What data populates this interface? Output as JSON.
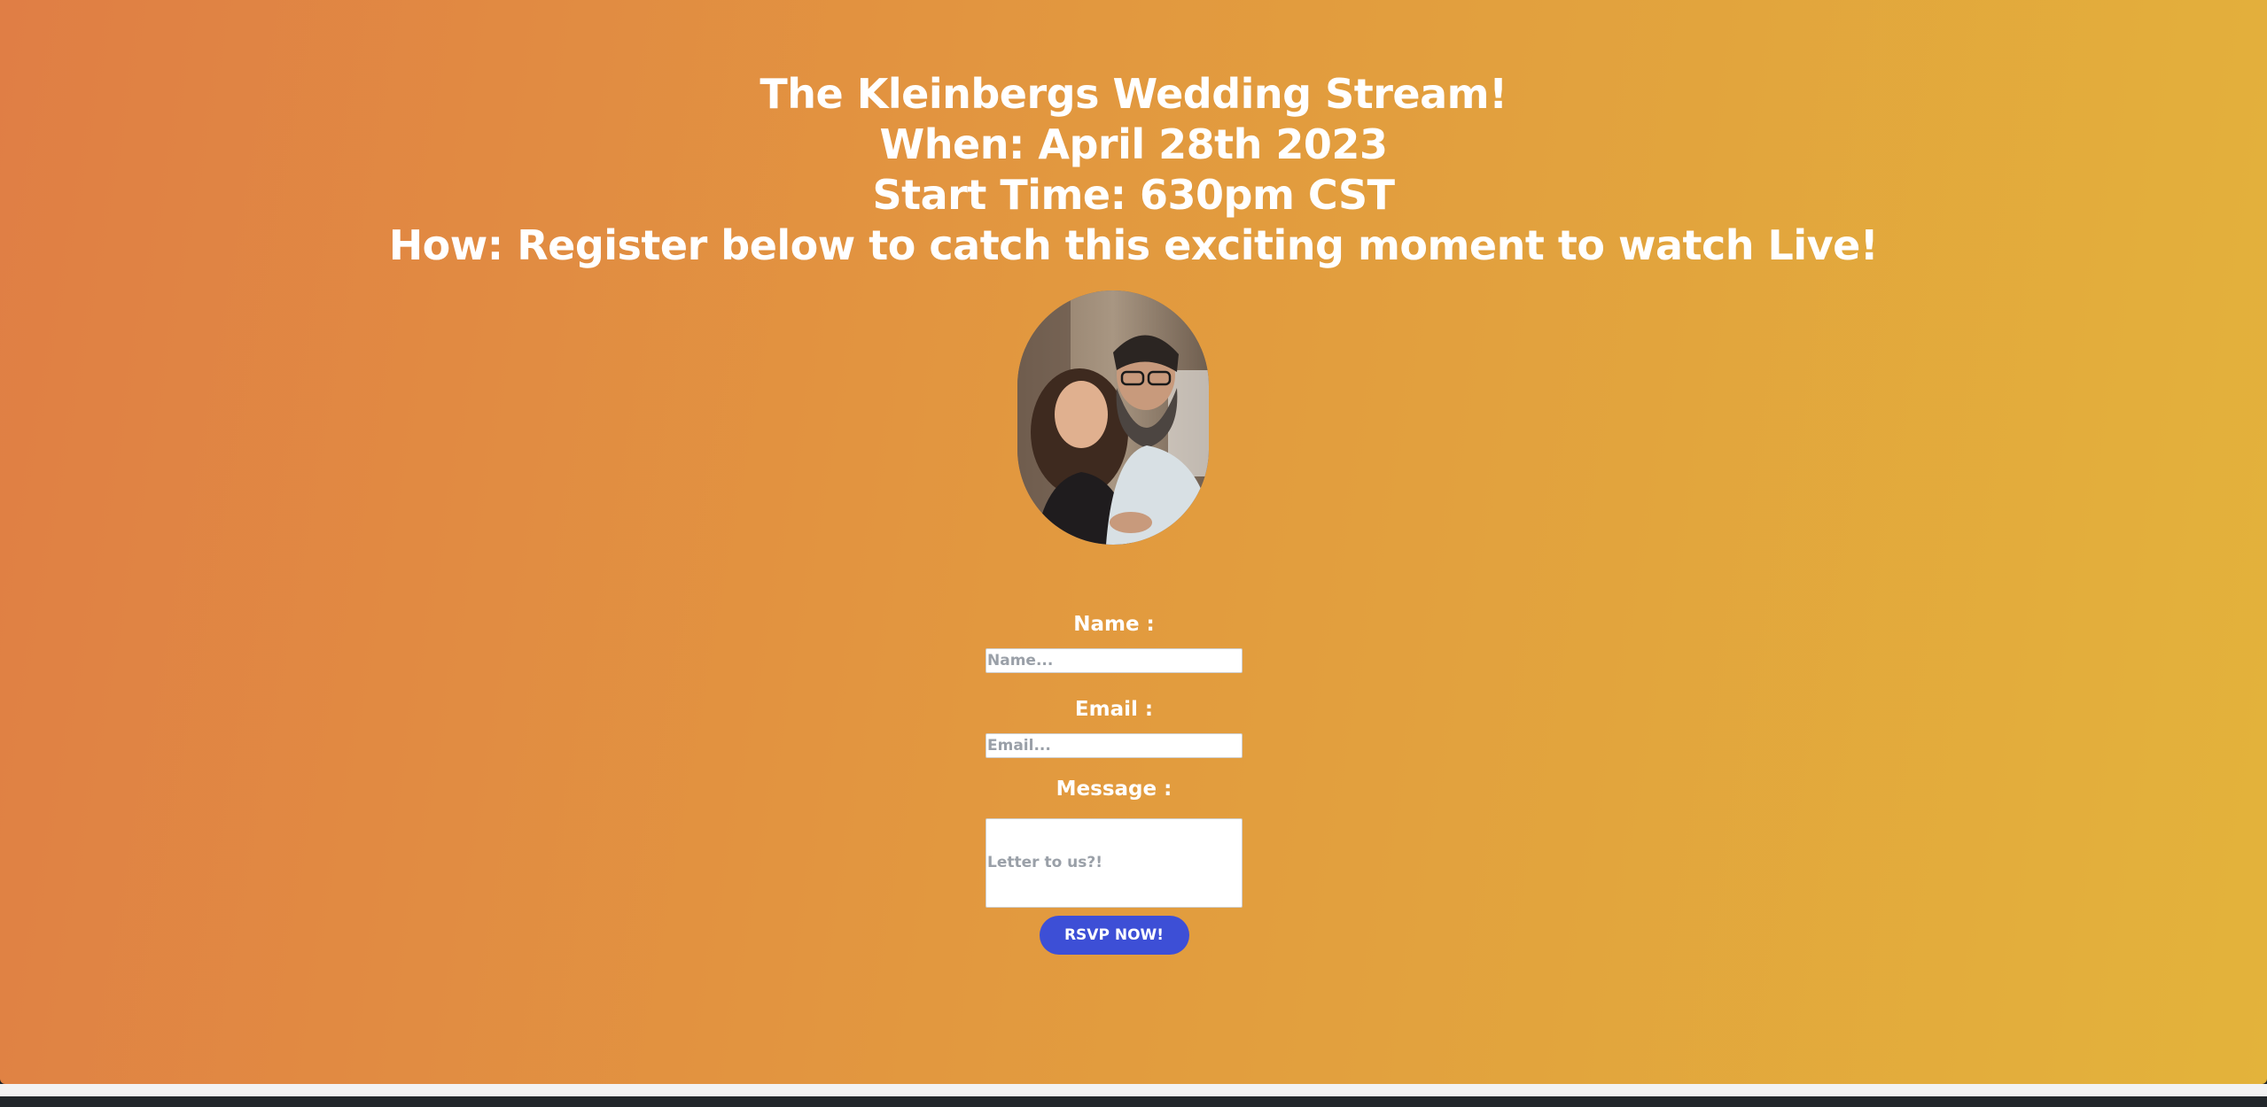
{
  "header": {
    "title": "The Kleinbergs Wedding Stream!",
    "when": "When: April 28th 2023",
    "start_time": "Start Time: 630pm CST",
    "how": "How: Register below to catch this exciting moment to watch Live!"
  },
  "photo": {
    "alt": "Couple photo"
  },
  "form": {
    "name_label": "Name :",
    "name_placeholder": "Name...",
    "name_value": "",
    "email_label": "Email :",
    "email_placeholder": "Email...",
    "email_value": "",
    "message_label": "Message :",
    "message_placeholder": "Letter to us?!",
    "message_value": "",
    "submit_label": "RSVP NOW!"
  },
  "colors": {
    "gradient_start": "#e07e45",
    "gradient_end": "#e3b33b",
    "button": "#3d4fd6",
    "text": "#ffffff"
  }
}
